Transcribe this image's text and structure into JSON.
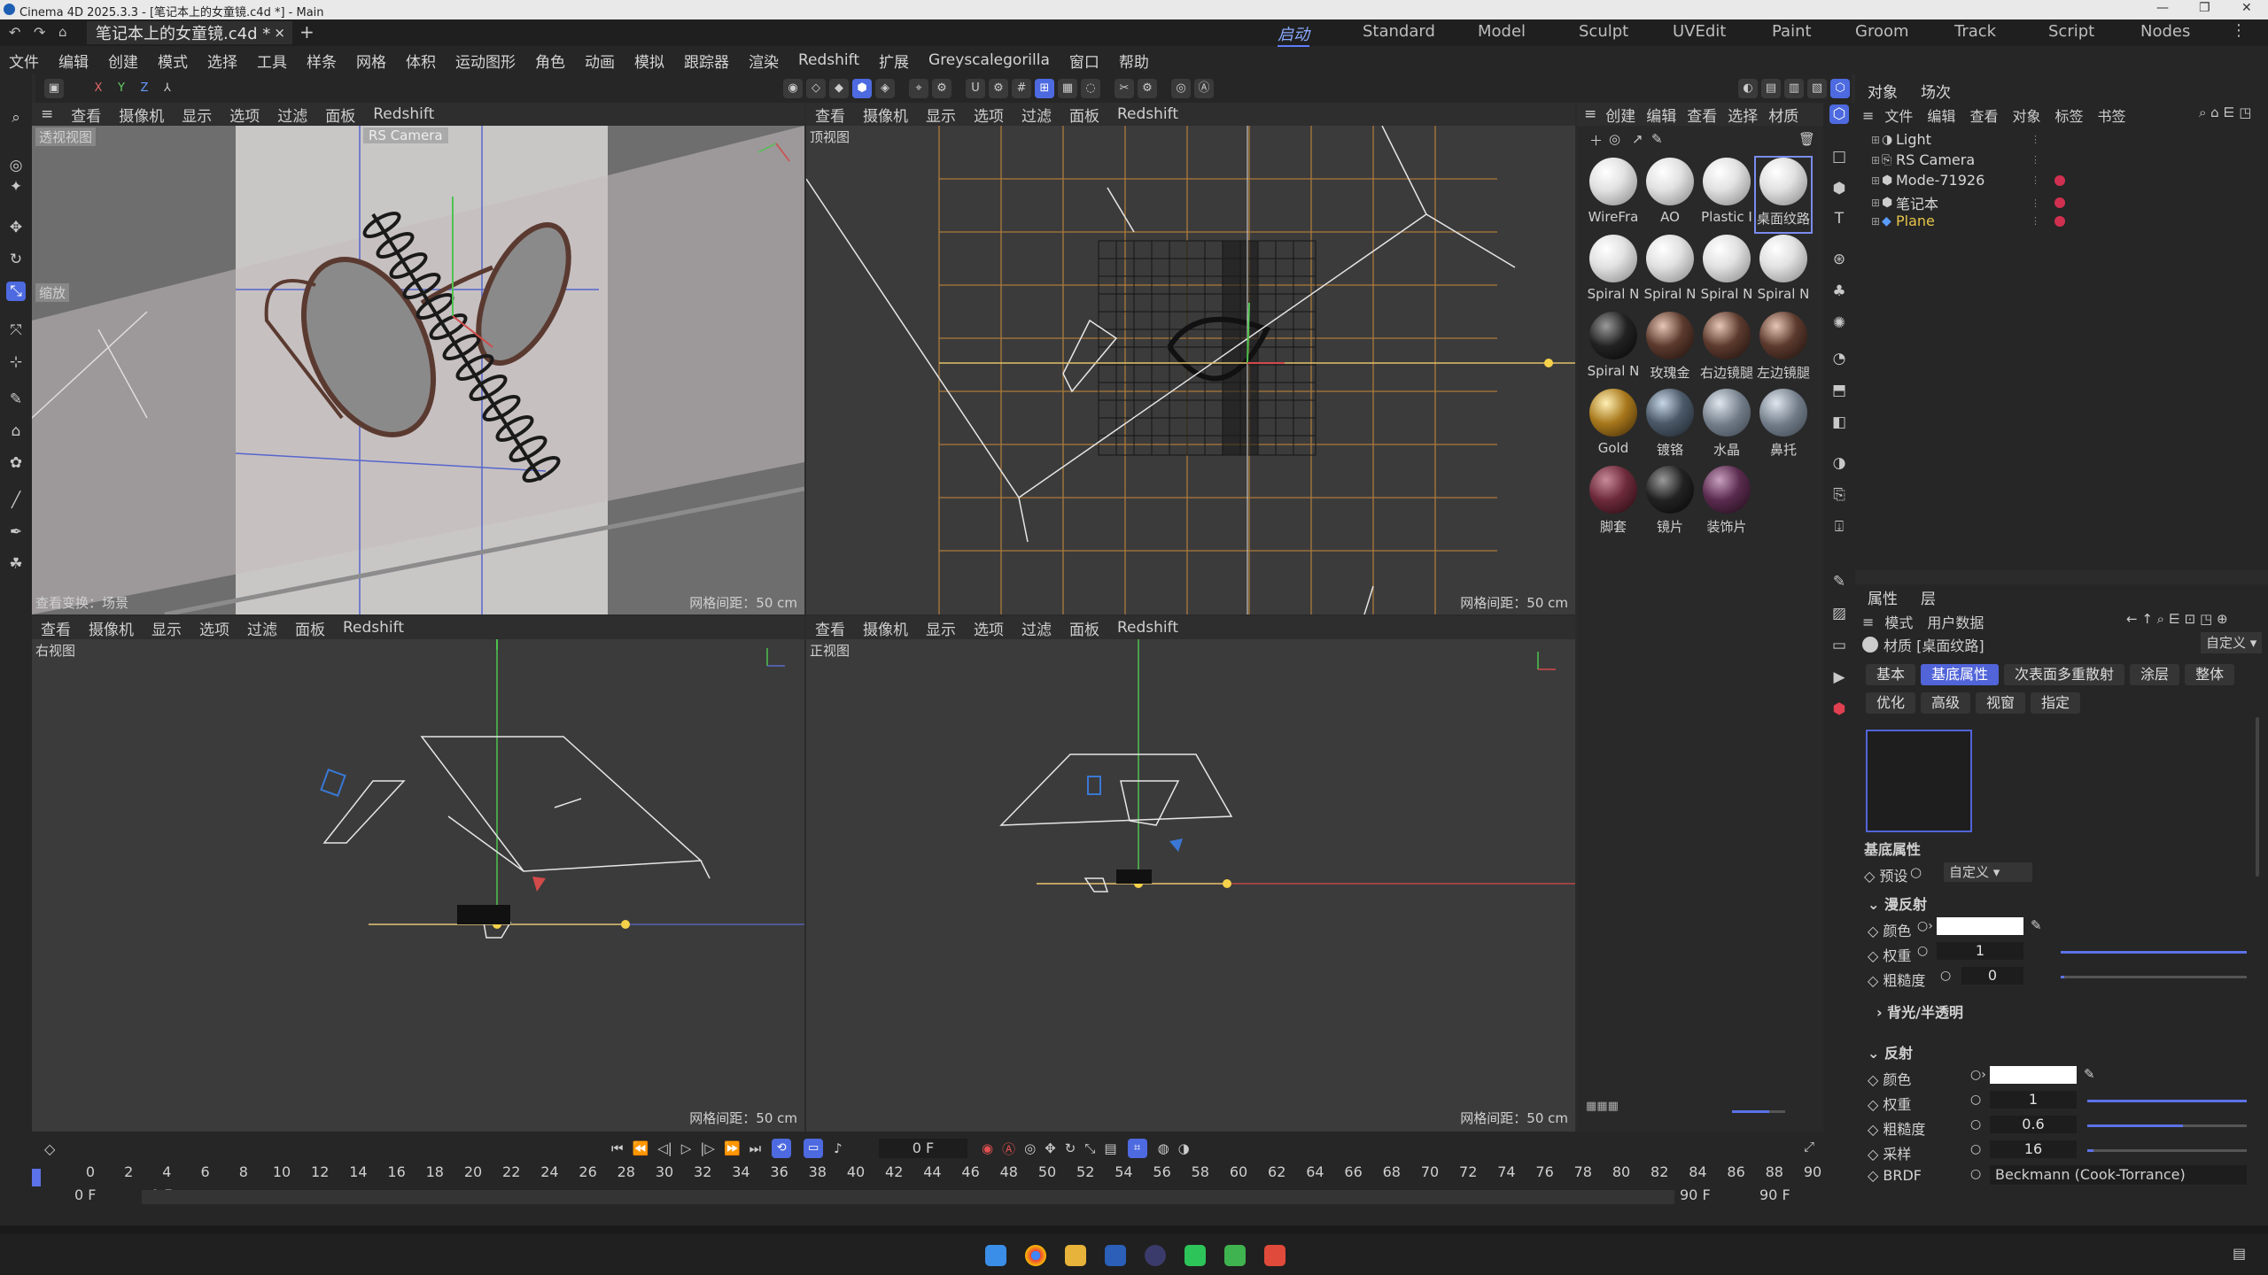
{
  "window": {
    "title": "Cinema 4D 2025.3.3 - [笔记本上的女童镜.c4d *] - Main"
  },
  "doc_tab": {
    "label": "笔记本上的女童镜.c4d *",
    "close": "×",
    "add": "+"
  },
  "layouts": [
    "启动",
    "Standard",
    "Model",
    "Sculpt",
    "UVEdit",
    "Paint",
    "Groom",
    "Track",
    "Script",
    "Nodes"
  ],
  "menu": [
    "文件",
    "编辑",
    "创建",
    "模式",
    "选择",
    "工具",
    "样条",
    "网格",
    "体积",
    "运动图形",
    "角色",
    "动画",
    "模拟",
    "跟踪器",
    "渲染",
    "Redshift",
    "扩展",
    "Greyscalegorilla",
    "窗口",
    "帮助"
  ],
  "axis_lock": [
    "X",
    "Y",
    "Z"
  ],
  "viewport_menu": [
    "查看",
    "摄像机",
    "显示",
    "选项",
    "过滤",
    "面板",
    "Redshift"
  ],
  "viewports": {
    "perspective": {
      "label": "透视视图",
      "camera": "RS Camera",
      "zoom_tag": "缩放",
      "bottom_left": "查看变换：场景",
      "grid": "网格间距：50 cm"
    },
    "top": {
      "label": "顶视图",
      "grid": "网格间距：50 cm"
    },
    "right": {
      "label": "右视图",
      "grid": "网格间距：50 cm"
    },
    "front": {
      "label": "正视图",
      "grid": "网格间距：50 cm"
    }
  },
  "material_menu": [
    "创建",
    "编辑",
    "查看",
    "选择",
    "材质"
  ],
  "materials": [
    {
      "name": "WireFra",
      "style": "white"
    },
    {
      "name": "AO",
      "style": "white"
    },
    {
      "name": "Plastic I",
      "style": "white"
    },
    {
      "name": "桌面纹路",
      "style": "white"
    },
    {
      "name": "Spiral N",
      "style": "white"
    },
    {
      "name": "Spiral N",
      "style": "white"
    },
    {
      "name": "Spiral N",
      "style": "white"
    },
    {
      "name": "Spiral N",
      "style": "white"
    },
    {
      "name": "Spiral N",
      "style": "dark"
    },
    {
      "name": "玫瑰金",
      "style": "rose"
    },
    {
      "name": "右边镜腿",
      "style": "rose"
    },
    {
      "name": "左边镜腿",
      "style": "rose"
    },
    {
      "name": "Gold",
      "style": "gold"
    },
    {
      "name": "镀铬",
      "style": "chrome"
    },
    {
      "name": "水晶",
      "style": "glass"
    },
    {
      "name": "鼻托",
      "style": "glass"
    },
    {
      "name": "脚套",
      "style": "wine"
    },
    {
      "name": "镜片",
      "style": "dark"
    },
    {
      "name": "装饰片",
      "style": "plum"
    }
  ],
  "object_panel": {
    "tabs": [
      "对象",
      "场次"
    ],
    "menu": [
      "文件",
      "编辑",
      "查看",
      "对象",
      "标签",
      "书签"
    ],
    "objects": [
      {
        "name": "Light",
        "selected": false
      },
      {
        "name": "RS Camera",
        "selected": false
      },
      {
        "name": "Mode-71926",
        "selected": false
      },
      {
        "name": "笔记本",
        "selected": false
      },
      {
        "name": "Plane",
        "selected": true
      }
    ]
  },
  "attr_panel": {
    "tabs": [
      "属性",
      "层"
    ],
    "menu": [
      "模式",
      "用户数据"
    ],
    "material_title": "材质 [桌面纹路]",
    "custom_dropdown": "自定义",
    "buttons_row1": [
      "基本",
      "基底属性",
      "次表面多重散射",
      "涂层",
      "整体"
    ],
    "buttons_row2": [
      "优化",
      "高级",
      "视窗",
      "指定"
    ],
    "active_button": "基底属性",
    "section_title": "基底属性",
    "preset_label": "预设",
    "preset_value": "自定义",
    "diffuse": {
      "title": "漫反射",
      "color_label": "颜色",
      "weight_label": "权重",
      "weight": "1",
      "weight_frac": 1.0,
      "rough_label": "粗糙度",
      "rough": "0",
      "rough_frac": 0.0
    },
    "backlight": "背光/半透明",
    "reflection": {
      "title": "反射",
      "color_label": "颜色",
      "weight_label": "权重",
      "weight": "1",
      "weight_frac": 1.0,
      "rough_label": "粗糙度",
      "rough": "0.6",
      "rough_frac": 0.6,
      "samples_label": "采样",
      "samples": "16",
      "samples_frac": 0.04,
      "brdf_label": "BRDF",
      "brdf": "Beckmann (Cook-Torrance)"
    }
  },
  "timeline": {
    "current_frame": "0 F",
    "start": "0 F",
    "start2": "0 F",
    "end": "90 F",
    "end2": "90 F",
    "ticks": [
      "0",
      "2",
      "4",
      "6",
      "8",
      "10",
      "12",
      "14",
      "16",
      "18",
      "20",
      "22",
      "24",
      "26",
      "28",
      "30",
      "32",
      "34",
      "36",
      "38",
      "40",
      "42",
      "44",
      "46",
      "48",
      "50",
      "52",
      "54",
      "56",
      "58",
      "60",
      "62",
      "64",
      "66",
      "68",
      "70",
      "72",
      "74",
      "76",
      "78",
      "80",
      "82",
      "84",
      "86",
      "88",
      "90"
    ]
  },
  "colors": {
    "accent": "#4d6ae0",
    "bg": "#2b2b2b",
    "viewport": "#3b3b3b",
    "axis_x": "#d24a4a",
    "axis_y": "#4ec24e",
    "grid_orange": "#c98a3a"
  }
}
